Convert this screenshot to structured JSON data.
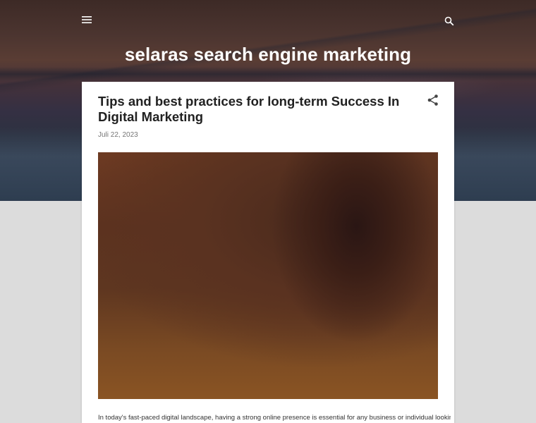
{
  "header": {
    "blog_title": "selaras search engine marketing",
    "menu_icon": "hamburger-menu-icon",
    "search_icon": "search-icon"
  },
  "post": {
    "title": "Tips and best practices for long-term Success In Digital Marketing",
    "date": "Juli 22, 2023",
    "share_icon": "share-icon",
    "excerpt": "In today's fast-paced digital landscape, having a strong online presence is essential for any business or individual looking"
  },
  "colors": {
    "page_background": "#dcdcdc",
    "card_background": "#ffffff",
    "title_text": "#212121",
    "date_text": "#757575",
    "header_text": "#ffffff"
  }
}
